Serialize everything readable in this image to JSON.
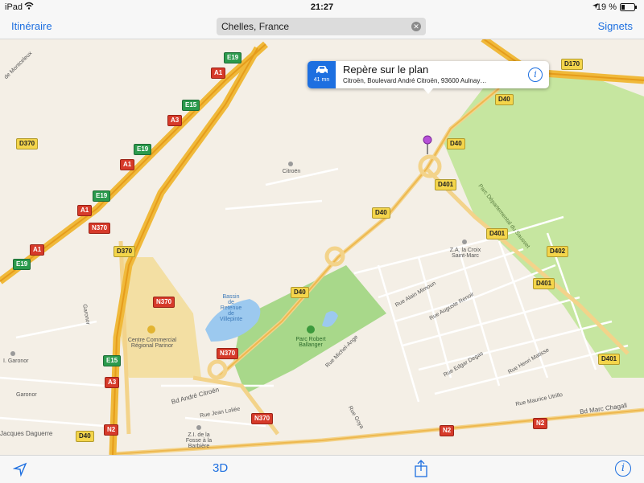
{
  "status_bar": {
    "carrier": "iPad",
    "time": "21:27",
    "battery": "19 %"
  },
  "nav": {
    "left_label": "Itinéraire",
    "right_label": "Signets",
    "search_value": "Chelles, France"
  },
  "callout": {
    "eta": "41 mn",
    "title": "Repère sur le plan",
    "subtitle": "Citroën, Boulevard André Citroën, 93600 Aulnay…"
  },
  "toolbar": {
    "mode_label": "3D",
    "icons": [
      "location-arrow-icon",
      "share-icon",
      "info-icon"
    ]
  },
  "map": {
    "shields": {
      "e19_a": "E19",
      "e19_b": "E19",
      "e19_c": "E19",
      "e19_d": "E19",
      "e15_a": "E15",
      "e15_b": "E15",
      "a1_a": "A1",
      "a1_b": "A1",
      "a1_c": "A1",
      "a1_d": "A1",
      "a3_a": "A3",
      "a3_b": "A3",
      "n370_a": "N370",
      "n370_b": "N370",
      "n370_c": "N370",
      "n370_d": "N370",
      "n2_a": "N2",
      "n2_b": "N2",
      "n2_c": "N2",
      "d370_a": "D370",
      "d370_b": "D370",
      "d40_a": "D40",
      "d40_b": "D40",
      "d40_c": "D40",
      "d40_d": "D40",
      "d40_e": "D40",
      "d401_a": "D401",
      "d401_b": "D401",
      "d401_c": "D401",
      "d401_d": "D401",
      "d402": "D402",
      "d170": "D170"
    },
    "labels": {
      "citroen": "Citroën",
      "za_croix": "Z.A. la Croix\nSaint-Marc",
      "bassin": "Bassin\nde\nRetenue\nde\nVillepinte",
      "parc_robert": "Parc Robert\nBallanger",
      "centre": "Centre Commercial\nRégional Parinor",
      "zi_fosse": "Z.I. de la\nFosse à la\nBarbière",
      "garonor_a": "I. Garonor",
      "garonor_b": "Garonor",
      "garonor_c": "Garonor",
      "daguerre": "Jacques Daguerre",
      "bd_andre": "Bd André Citroën",
      "bd_chagall": "Bd Marc Chagall",
      "rue_loliee": "Rue Jean Loliée",
      "rue_mimoun": "Rue Alain Mimoun",
      "rue_renoir": "Rue Auguste Renoir",
      "rue_degas": "Rue Edgar Degas",
      "rue_matisse": "Rue Henri Matisse",
      "rue_utrillo": "Rue Maurice Utrillo",
      "rue_goya": "Rue Goya",
      "rue_ange": "Rue Michel-Ange",
      "parc_dep": "Parc Départemental du Sausset",
      "montceleux": "de Montceleux"
    }
  }
}
